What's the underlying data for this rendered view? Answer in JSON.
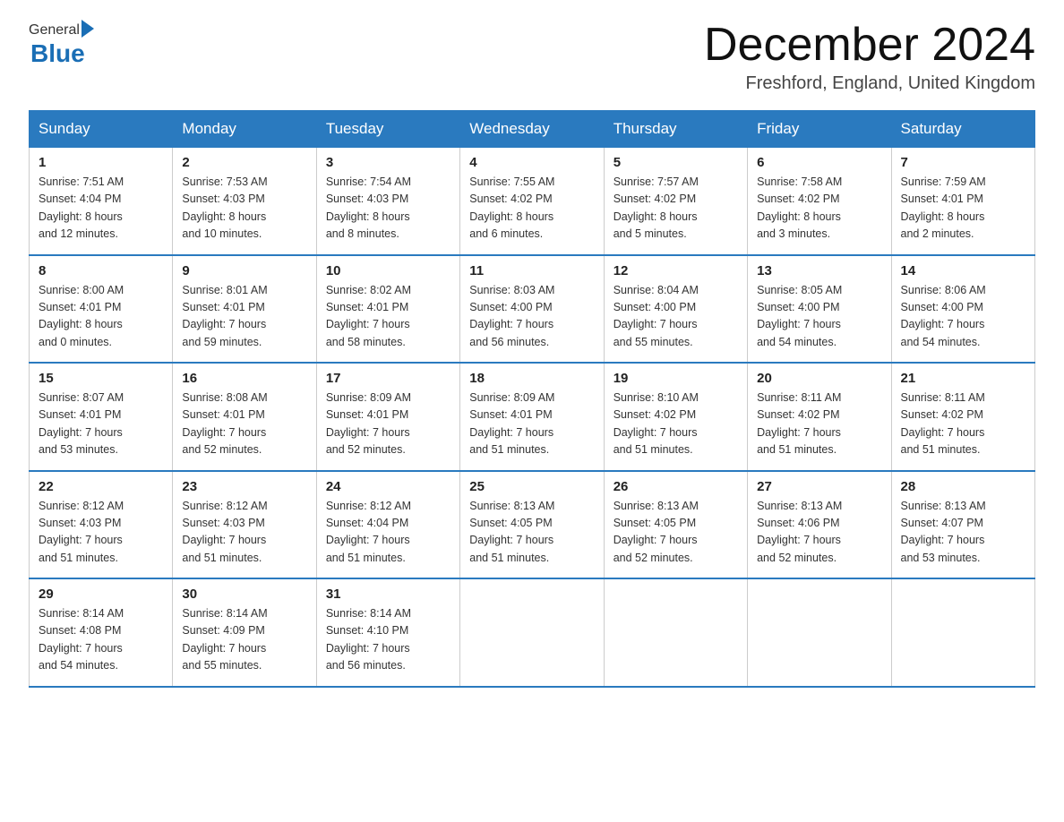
{
  "header": {
    "logo_general": "General",
    "logo_blue": "Blue",
    "month_title": "December 2024",
    "location": "Freshford, England, United Kingdom"
  },
  "days_of_week": [
    "Sunday",
    "Monday",
    "Tuesday",
    "Wednesday",
    "Thursday",
    "Friday",
    "Saturday"
  ],
  "weeks": [
    [
      {
        "day": "1",
        "info": "Sunrise: 7:51 AM\nSunset: 4:04 PM\nDaylight: 8 hours\nand 12 minutes."
      },
      {
        "day": "2",
        "info": "Sunrise: 7:53 AM\nSunset: 4:03 PM\nDaylight: 8 hours\nand 10 minutes."
      },
      {
        "day": "3",
        "info": "Sunrise: 7:54 AM\nSunset: 4:03 PM\nDaylight: 8 hours\nand 8 minutes."
      },
      {
        "day": "4",
        "info": "Sunrise: 7:55 AM\nSunset: 4:02 PM\nDaylight: 8 hours\nand 6 minutes."
      },
      {
        "day": "5",
        "info": "Sunrise: 7:57 AM\nSunset: 4:02 PM\nDaylight: 8 hours\nand 5 minutes."
      },
      {
        "day": "6",
        "info": "Sunrise: 7:58 AM\nSunset: 4:02 PM\nDaylight: 8 hours\nand 3 minutes."
      },
      {
        "day": "7",
        "info": "Sunrise: 7:59 AM\nSunset: 4:01 PM\nDaylight: 8 hours\nand 2 minutes."
      }
    ],
    [
      {
        "day": "8",
        "info": "Sunrise: 8:00 AM\nSunset: 4:01 PM\nDaylight: 8 hours\nand 0 minutes."
      },
      {
        "day": "9",
        "info": "Sunrise: 8:01 AM\nSunset: 4:01 PM\nDaylight: 7 hours\nand 59 minutes."
      },
      {
        "day": "10",
        "info": "Sunrise: 8:02 AM\nSunset: 4:01 PM\nDaylight: 7 hours\nand 58 minutes."
      },
      {
        "day": "11",
        "info": "Sunrise: 8:03 AM\nSunset: 4:00 PM\nDaylight: 7 hours\nand 56 minutes."
      },
      {
        "day": "12",
        "info": "Sunrise: 8:04 AM\nSunset: 4:00 PM\nDaylight: 7 hours\nand 55 minutes."
      },
      {
        "day": "13",
        "info": "Sunrise: 8:05 AM\nSunset: 4:00 PM\nDaylight: 7 hours\nand 54 minutes."
      },
      {
        "day": "14",
        "info": "Sunrise: 8:06 AM\nSunset: 4:00 PM\nDaylight: 7 hours\nand 54 minutes."
      }
    ],
    [
      {
        "day": "15",
        "info": "Sunrise: 8:07 AM\nSunset: 4:01 PM\nDaylight: 7 hours\nand 53 minutes."
      },
      {
        "day": "16",
        "info": "Sunrise: 8:08 AM\nSunset: 4:01 PM\nDaylight: 7 hours\nand 52 minutes."
      },
      {
        "day": "17",
        "info": "Sunrise: 8:09 AM\nSunset: 4:01 PM\nDaylight: 7 hours\nand 52 minutes."
      },
      {
        "day": "18",
        "info": "Sunrise: 8:09 AM\nSunset: 4:01 PM\nDaylight: 7 hours\nand 51 minutes."
      },
      {
        "day": "19",
        "info": "Sunrise: 8:10 AM\nSunset: 4:02 PM\nDaylight: 7 hours\nand 51 minutes."
      },
      {
        "day": "20",
        "info": "Sunrise: 8:11 AM\nSunset: 4:02 PM\nDaylight: 7 hours\nand 51 minutes."
      },
      {
        "day": "21",
        "info": "Sunrise: 8:11 AM\nSunset: 4:02 PM\nDaylight: 7 hours\nand 51 minutes."
      }
    ],
    [
      {
        "day": "22",
        "info": "Sunrise: 8:12 AM\nSunset: 4:03 PM\nDaylight: 7 hours\nand 51 minutes."
      },
      {
        "day": "23",
        "info": "Sunrise: 8:12 AM\nSunset: 4:03 PM\nDaylight: 7 hours\nand 51 minutes."
      },
      {
        "day": "24",
        "info": "Sunrise: 8:12 AM\nSunset: 4:04 PM\nDaylight: 7 hours\nand 51 minutes."
      },
      {
        "day": "25",
        "info": "Sunrise: 8:13 AM\nSunset: 4:05 PM\nDaylight: 7 hours\nand 51 minutes."
      },
      {
        "day": "26",
        "info": "Sunrise: 8:13 AM\nSunset: 4:05 PM\nDaylight: 7 hours\nand 52 minutes."
      },
      {
        "day": "27",
        "info": "Sunrise: 8:13 AM\nSunset: 4:06 PM\nDaylight: 7 hours\nand 52 minutes."
      },
      {
        "day": "28",
        "info": "Sunrise: 8:13 AM\nSunset: 4:07 PM\nDaylight: 7 hours\nand 53 minutes."
      }
    ],
    [
      {
        "day": "29",
        "info": "Sunrise: 8:14 AM\nSunset: 4:08 PM\nDaylight: 7 hours\nand 54 minutes."
      },
      {
        "day": "30",
        "info": "Sunrise: 8:14 AM\nSunset: 4:09 PM\nDaylight: 7 hours\nand 55 minutes."
      },
      {
        "day": "31",
        "info": "Sunrise: 8:14 AM\nSunset: 4:10 PM\nDaylight: 7 hours\nand 56 minutes."
      },
      null,
      null,
      null,
      null
    ]
  ]
}
